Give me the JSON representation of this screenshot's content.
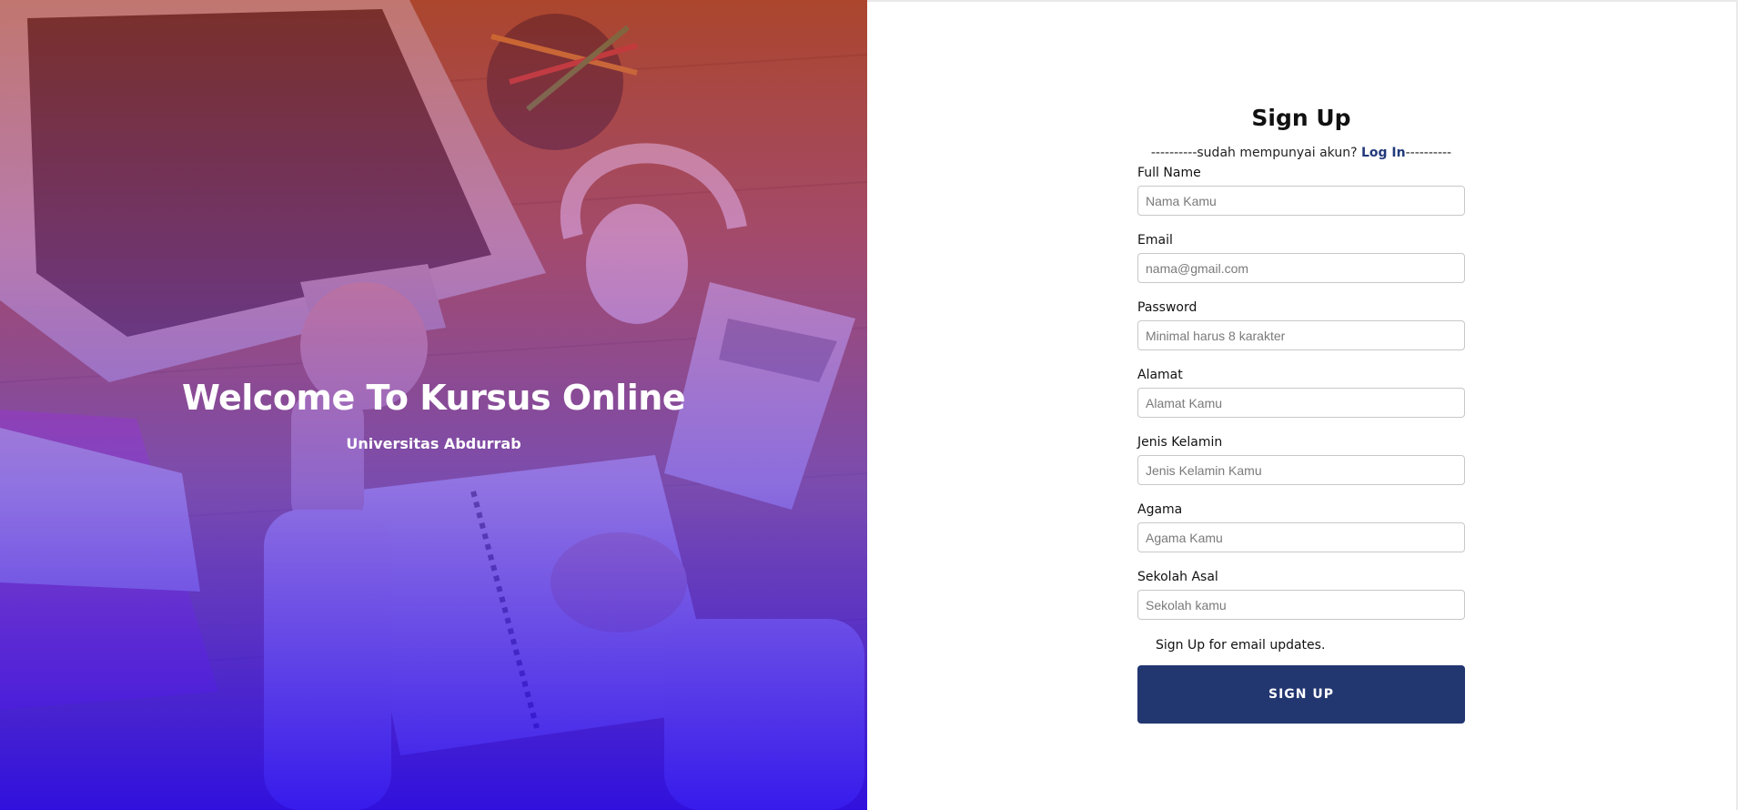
{
  "hero": {
    "title": "Welcome To Kursus Online",
    "subtitle": "Universitas Abdurrab",
    "overlay_colors": [
      "#ba3422",
      "#aa3c96",
      "#6e46dc",
      "#280aeb"
    ]
  },
  "form": {
    "title": "Sign Up",
    "login_prefix": "----------sudah mempunyai akun? ",
    "login_link": "Log In",
    "login_suffix": "----------",
    "fields": [
      {
        "label": "Full Name",
        "placeholder": "Nama Kamu",
        "value": ""
      },
      {
        "label": "Email",
        "placeholder": "nama@gmail.com",
        "value": ""
      },
      {
        "label": "Password",
        "placeholder": "Minimal harus 8 karakter",
        "value": ""
      },
      {
        "label": "Alamat",
        "placeholder": "Alamat Kamu",
        "value": ""
      },
      {
        "label": "Jenis Kelamin",
        "placeholder": "Jenis Kelamin Kamu",
        "value": ""
      },
      {
        "label": "Agama",
        "placeholder": "Agama Kamu",
        "value": ""
      },
      {
        "label": "Sekolah Asal",
        "placeholder": "Sekolah kamu",
        "value": ""
      }
    ],
    "checkbox_label": "Sign Up for email updates.",
    "submit_label": "SIGN UP",
    "accent_color": "#223670",
    "link_color": "#223a7a"
  }
}
